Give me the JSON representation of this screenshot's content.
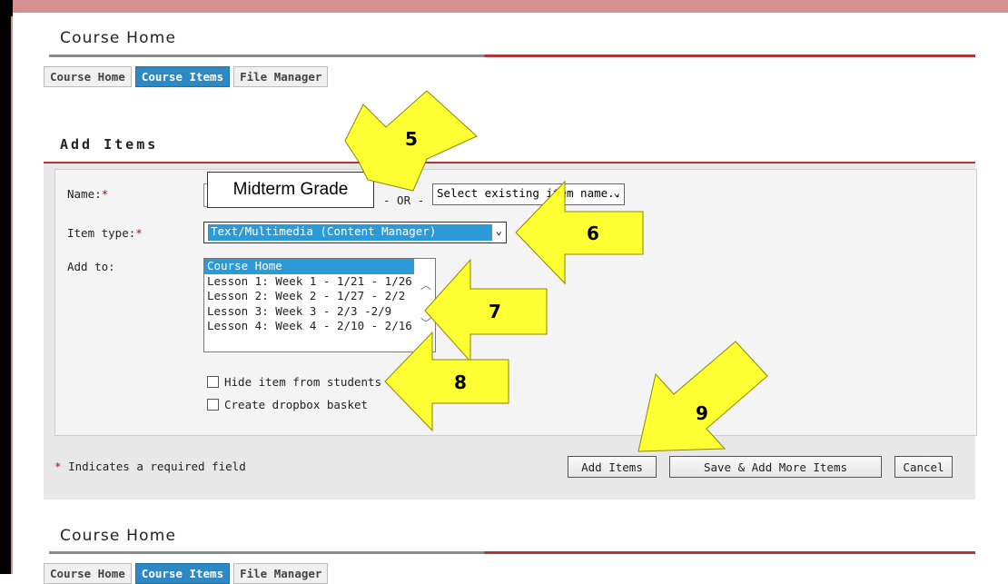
{
  "top_section": {
    "title": "Course Home",
    "tabs": [
      {
        "label": "Course Home",
        "active": false
      },
      {
        "label": "Course Items",
        "active": true
      },
      {
        "label": "File Manager",
        "active": false
      }
    ]
  },
  "add_items": {
    "heading": "Add Items",
    "name_label": "Name:",
    "required_mark": "*",
    "name_value": "Midterm Grade",
    "or_text": "- OR -",
    "existing_item_select": "Select existing item name...",
    "item_type_label": "Item type:",
    "item_type_value": "Text/Multimedia (Content Manager)",
    "add_to_label": "Add to:",
    "add_to_options": [
      "Course Home",
      "Lesson 1: Week 1 - 1/21 - 1/26",
      "Lesson 2: Week 2 - 1/27 - 2/2",
      "Lesson 3: Week 3 - 2/3 -2/9",
      "Lesson 4: Week 4 - 2/10 - 2/16"
    ],
    "hide_item_label": "Hide item from students",
    "dropbox_label": "Create dropbox basket",
    "required_note": "Indicates a required field",
    "buttons": {
      "add_items": "Add Items",
      "save_add_more": "Save & Add More Items",
      "cancel": "Cancel"
    }
  },
  "bottom_section": {
    "title": "Course Home",
    "tabs": [
      {
        "label": "Course Home",
        "active": false
      },
      {
        "label": "Course Items",
        "active": true
      },
      {
        "label": "File Manager",
        "active": false
      }
    ]
  },
  "annotations": {
    "step5": "5",
    "step6": "6",
    "step7": "7",
    "step8": "8",
    "step9": "9",
    "arrow_color": "#ffff33"
  },
  "colors": {
    "accent_tab": "#2d88c4",
    "rule_red": "#b33434",
    "background_pink": "#d59090"
  }
}
